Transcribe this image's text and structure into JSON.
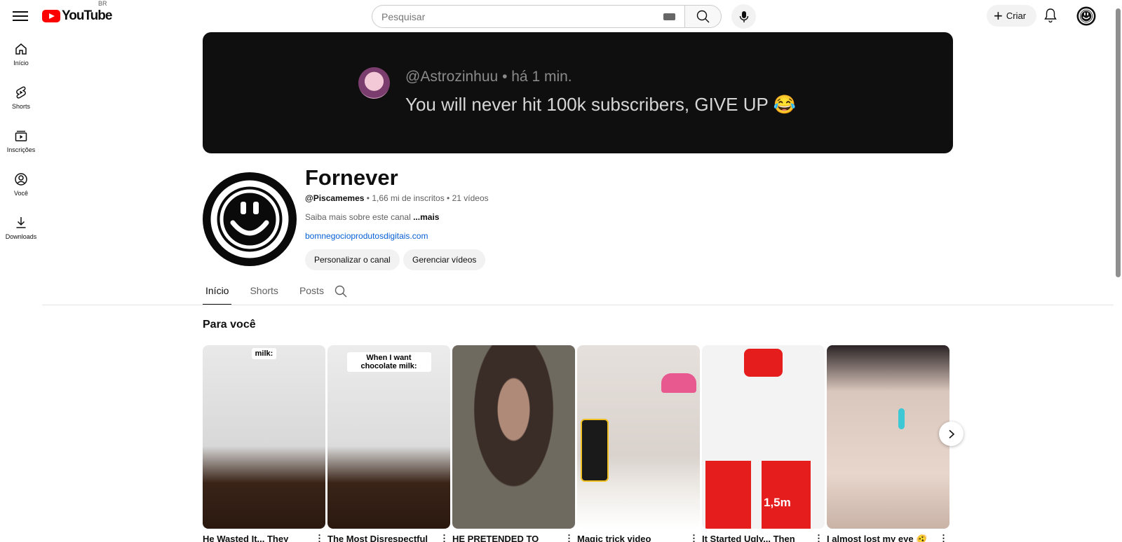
{
  "header": {
    "logo_text": "YouTube",
    "country_code": "BR",
    "search_placeholder": "Pesquisar",
    "create_label": "Criar"
  },
  "sidebar": {
    "items": [
      {
        "label": "Início",
        "icon": "home-icon"
      },
      {
        "label": "Shorts",
        "icon": "shorts-icon"
      },
      {
        "label": "Inscrições",
        "icon": "subscriptions-icon"
      },
      {
        "label": "Você",
        "icon": "you-icon"
      },
      {
        "label": "Downloads",
        "icon": "download-icon"
      }
    ]
  },
  "banner": {
    "username": "@Astrozinhuu",
    "time": "há 1 min.",
    "message": "You will never hit 100k subscribers, GIVE UP 😂"
  },
  "channel": {
    "name": "Fornever",
    "handle": "@Piscamemes",
    "subscribers": "1,66 mi de inscritos",
    "videos": "21 vídeos",
    "description": "Saiba mais sobre este canal",
    "more_label": "...mais",
    "link": "bomnegocioprodutosdigitais.com",
    "customize_label": "Personalizar o canal",
    "manage_label": "Gerenciar vídeos"
  },
  "tabs": [
    {
      "label": "Início",
      "active": true
    },
    {
      "label": "Shorts",
      "active": false
    },
    {
      "label": "Posts",
      "active": false
    }
  ],
  "section": {
    "title": "Para você",
    "cards": [
      {
        "title": "He Wasted It... They",
        "caption": "milk:",
        "colors": [
          "#e9e9e9",
          "#3a2418"
        ]
      },
      {
        "title": "The Most Disrespectful",
        "caption": "When I want chocolate milk:",
        "colors": [
          "#ececec",
          "#3a2418"
        ]
      },
      {
        "title": "HE PRETENDED TO",
        "caption": "",
        "colors": [
          "#6f6a60",
          "#1c1b2a"
        ]
      },
      {
        "title": "Magic trick video",
        "caption": "",
        "colors": [
          "#e6e0dc",
          "#e85a8f"
        ]
      },
      {
        "title": "It Started Ugly... Then",
        "caption": "",
        "overlay": "1,5m",
        "colors": [
          "#f3f3f3",
          "#e61d1d"
        ]
      },
      {
        "title": "I almost lost my eye 🫨",
        "caption": "",
        "colors": [
          "#d9c6bc",
          "#2a2324"
        ]
      }
    ]
  }
}
